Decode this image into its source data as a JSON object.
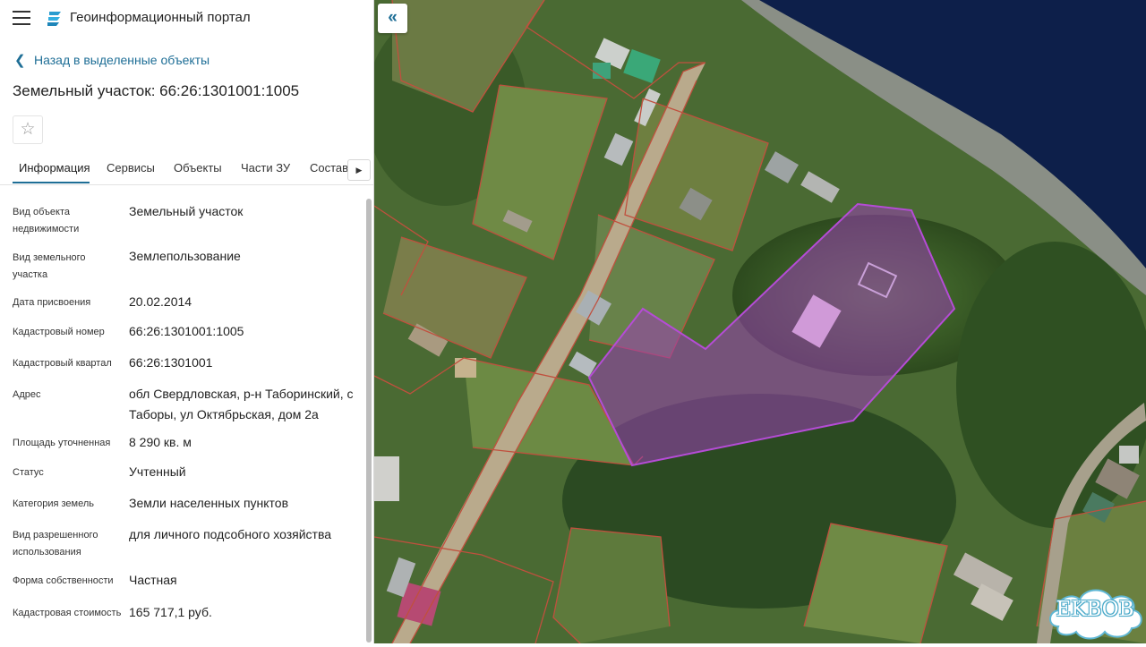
{
  "header": {
    "app_title": "Геоинформационный портал",
    "menu_icon": "hamburger-menu-icon",
    "logo_icon": "portal-logo-icon"
  },
  "navigation": {
    "back_label": "Назад в выделенные объекты",
    "back_icon": "chevron-left-icon"
  },
  "object": {
    "title": "Земельный участок: 66:26:1301001:1005",
    "favorite_icon": "star-outline-icon"
  },
  "tabs": [
    {
      "label": "Информация",
      "active": true
    },
    {
      "label": "Сервисы"
    },
    {
      "label": "Объекты"
    },
    {
      "label": "Части ЗУ"
    },
    {
      "label": "Состав"
    }
  ],
  "tab_next_icon": "caret-right-icon",
  "properties": [
    {
      "label": "Вид объекта недвижимости",
      "value": "Земельный участок"
    },
    {
      "label": "Вид земельного участка",
      "value": "Землепользование"
    },
    {
      "label": "Дата присвоения",
      "value": "20.02.2014"
    },
    {
      "label": "Кадастровый номер",
      "value": "66:26:1301001:1005"
    },
    {
      "label": "Кадастровый квартал",
      "value": "66:26:1301001"
    },
    {
      "label": "Адрес",
      "value": "обл Свердловская, р-н Таборинский, с Таборы, ул Октябрьская, дом 2а"
    },
    {
      "label": "Площадь уточненная",
      "value": "8 290 кв. м"
    },
    {
      "label": "Статус",
      "value": "Учтенный"
    },
    {
      "label": "Категория земель",
      "value": "Земли населенных пунктов"
    },
    {
      "label": "Вид разрешенного использования",
      "value": "для личного подсобного хозяйства"
    },
    {
      "label": "Форма собственности",
      "value": "Частная"
    },
    {
      "label": "Кадастровая стоимость",
      "value": "165 717,1 руб."
    }
  ],
  "map": {
    "collapse_icon": "double-chevron-left-icon",
    "parcel_color": "#9b3fb5",
    "boundary_color": "#c0503e",
    "water_color": "#0d1f4a"
  },
  "watermark": {
    "text": "EKBOB"
  }
}
